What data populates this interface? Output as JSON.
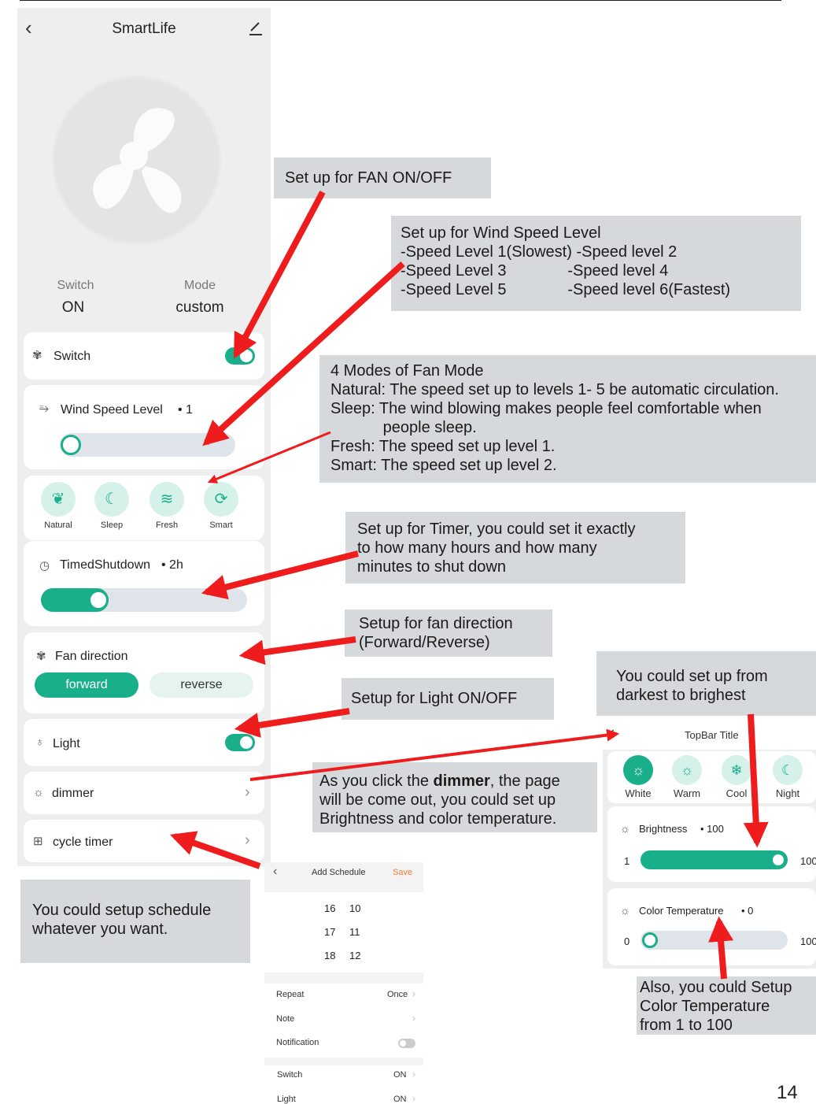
{
  "app": {
    "title": "SmartLife",
    "back_icon": "chevron-left-icon",
    "edit_icon": "pencil-icon",
    "status": {
      "switch_label": "Switch",
      "switch_value": "ON",
      "mode_label": "Mode",
      "mode_value": "custom"
    },
    "switch_row": {
      "label": "Switch",
      "icon": "fan-icon",
      "on": true
    },
    "wind_speed": {
      "label": "Wind Speed Level",
      "value": "• 1",
      "icon": "wind-icon",
      "level": 1,
      "max": 6
    },
    "modes": [
      {
        "label": "Natural",
        "icon": "leaf-icon"
      },
      {
        "label": "Sleep",
        "icon": "moon-icon"
      },
      {
        "label": "Fresh",
        "icon": "wind-icon"
      },
      {
        "label": "Smart",
        "icon": "auto-icon"
      }
    ],
    "timer": {
      "label": "TimedShutdown",
      "value": "• 2h",
      "icon": "clock-icon",
      "fill_fraction": 0.27
    },
    "direction": {
      "label": "Fan direction",
      "icon": "fan-icon",
      "forward": "forward",
      "reverse": "reverse"
    },
    "light": {
      "label": "Light",
      "icon": "bulb-icon",
      "on": true
    },
    "dimmer": {
      "label": "dimmer",
      "icon": "sun-icon"
    },
    "cycle_timer": {
      "label": "cycle timer",
      "icon": "grid-icon"
    }
  },
  "callouts": {
    "fan_onoff": "Set up for FAN ON/OFF",
    "wind_speed": "Set up for Wind Speed Level\n-Speed Level 1(Slowest) -Speed level 2\n-Speed Level 3              -Speed level 4\n-Speed Level 5              -Speed level 6(Fastest)",
    "modes": "4 Modes of Fan Mode\nNatural: The speed set up to levels 1- 5 be automatic circulation.\nSleep: The wind blowing makes people feel comfortable when\n            people sleep.\nFresh: The speed set up level 1.\nSmart: The speed set up level 2.",
    "timer": "Set up for Timer, you could set it exactly\nto how many hours and how many\nminutes to shut down",
    "direction": "Setup for fan direction\n(Forward/Reverse)",
    "light": "Setup for Light ON/OFF",
    "brightness": "You could set up from\ndarkest to brighest",
    "dimmer_pre": "As you click the ",
    "dimmer_bold": "dimmer",
    "dimmer_post": ", the page\nwill be come out, you could set up\nBrightness and color temperature.",
    "schedule": "You could setup schedule\nwhatever you want.",
    "color_temp": "Also, you could Setup\nColor Temperature\nfrom 1 to 100"
  },
  "schedule": {
    "title": "Add Schedule",
    "save": "Save",
    "times": [
      {
        "h": "16",
        "m": "10"
      },
      {
        "h": "17",
        "m": "11"
      },
      {
        "h": "18",
        "m": "12"
      }
    ],
    "repeat_label": "Repeat",
    "repeat_value": "Once",
    "note_label": "Note",
    "notification_label": "Notification",
    "switch_label": "Switch",
    "switch_value": "ON",
    "light_label": "Light",
    "light_value": "ON"
  },
  "light_panel": {
    "title": "TopBar Title",
    "modes": [
      {
        "label": "White",
        "icon": "sun-icon"
      },
      {
        "label": "Warm",
        "icon": "sun-icon"
      },
      {
        "label": "Cool",
        "icon": "snowflake-icon"
      },
      {
        "label": "Night",
        "icon": "moon-icon"
      }
    ],
    "brightness": {
      "label": "Brightness",
      "value": "• 100",
      "min": "1",
      "max": "100",
      "level": 100
    },
    "color_temp": {
      "label": "Color Temperature",
      "value": "• 0",
      "min": "0",
      "max": "100",
      "level": 0
    }
  },
  "colors": {
    "accent": "#1aaf8b",
    "arrow": "#ee1c1c",
    "callout_bg": "#d6d9dc"
  },
  "page_number": "14"
}
